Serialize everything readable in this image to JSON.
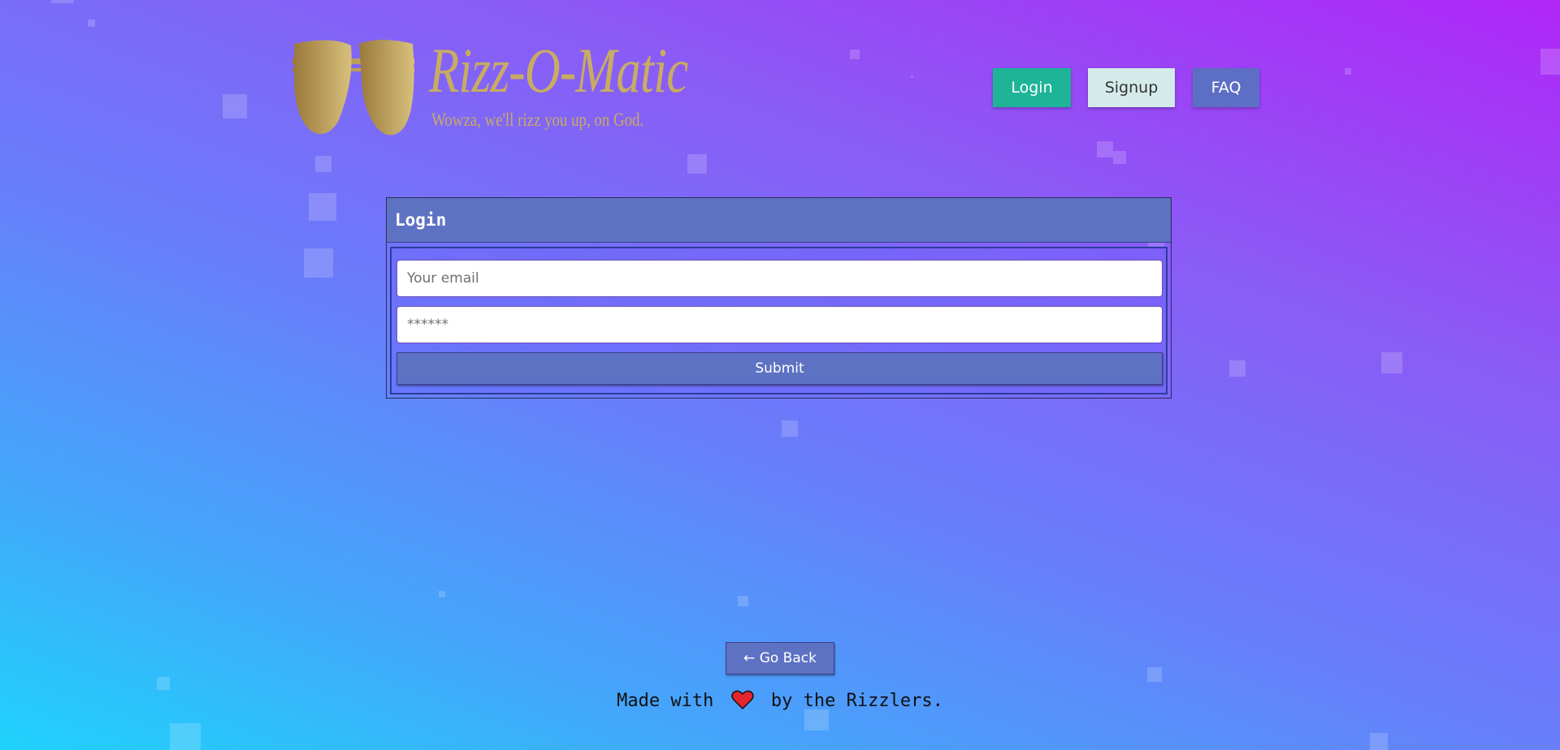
{
  "brand": {
    "title": "Rizz-O-Matic",
    "tagline": "Wowza, we'll rizz you up, on God.",
    "logo_icon": "sunglasses-icon",
    "logo_color": "#c8ac62"
  },
  "nav": {
    "login_label": "Login",
    "signup_label": "Signup",
    "faq_label": "FAQ"
  },
  "login_form": {
    "header": "Login",
    "email_placeholder": "Your email",
    "email_value": "",
    "password_placeholder": "******",
    "password_value": "",
    "submit_label": "Submit"
  },
  "back_button": {
    "label": "← Go Back"
  },
  "footer": {
    "prefix": "Made with",
    "heart_icon": "heart-icon",
    "suffix": "by the Rizzlers."
  },
  "colors": {
    "accent_green": "#1db497",
    "signup_bg": "#d4ebea",
    "primary_button": "#5e72c4",
    "heart": "#e3262c"
  }
}
